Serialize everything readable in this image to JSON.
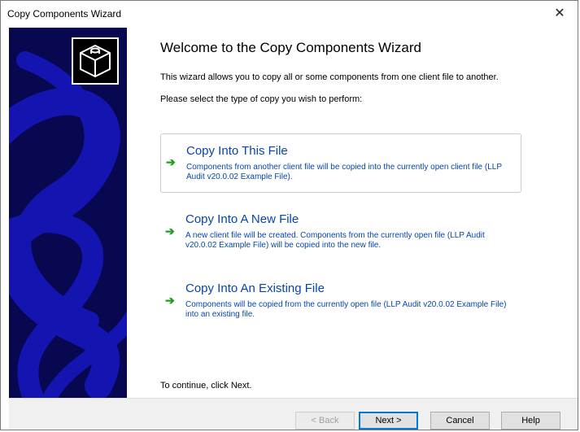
{
  "window": {
    "title": "Copy Components Wizard",
    "close_glyph": "✕",
    "close_icon": "close-icon"
  },
  "banner": {
    "logo_icon": "cube-logo-icon",
    "colors": {
      "background": "#07084f",
      "stripes": "#1414b0"
    }
  },
  "page": {
    "heading": "Welcome to the Copy Components Wizard",
    "intro": "This wizard allows you to copy all or some components from one client file to another.",
    "select_prompt": "Please select the type of copy you wish to perform:",
    "continue_text": "To continue, click Next."
  },
  "options": [
    {
      "title": "Copy Into This File",
      "description": "Components from another client file will be copied into the currently open client file (LLP Audit v20.0.02 Example File).",
      "selected": true,
      "icon": "green-arrow-icon"
    },
    {
      "title": "Copy Into A New File",
      "description": "A new client file will be created. Components from the currently open file (LLP Audit v20.0.02 Example File) will be copied into the new file.",
      "selected": false,
      "icon": "green-arrow-icon"
    },
    {
      "title": "Copy Into An Existing File",
      "description": "Components will be copied from the currently open file (LLP Audit v20.0.02 Example File) into an existing file.",
      "selected": false,
      "icon": "green-arrow-icon"
    }
  ],
  "arrow_glyph": "➔",
  "buttons": {
    "back": "< Back",
    "next": "Next >",
    "cancel": "Cancel",
    "help": "Help"
  },
  "colors": {
    "link_blue": "#0645ad",
    "arrow_green": "#1f9f1f",
    "accent": "#0078d7"
  }
}
